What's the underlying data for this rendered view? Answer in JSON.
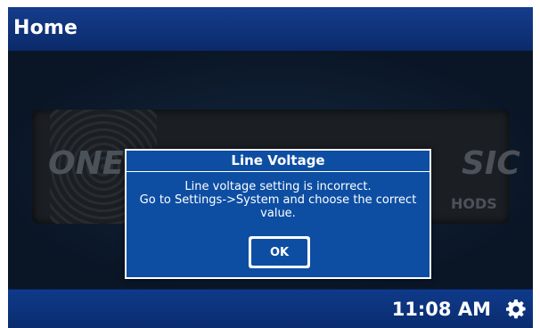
{
  "header": {
    "title": "Home"
  },
  "logo": {
    "left_word": "ONE",
    "right_word": "SIC",
    "sub_word": "HODS"
  },
  "dialog": {
    "title": "Line Voltage",
    "message": "Line voltage setting is incorrect.\nGo to Settings->System and choose the correct value.",
    "message_lines": [
      "Line voltage setting is incorrect.",
      "Go to Settings->System and choose the correct",
      "value."
    ],
    "ok_label": "OK"
  },
  "footer": {
    "time": "11:08 AM",
    "settings_icon": "gear-icon"
  },
  "colors": {
    "header_blue": "#153d8c",
    "dialog_blue": "#0d4ea3",
    "background_dark": "#0c1a2c",
    "text_white": "#ffffff"
  }
}
